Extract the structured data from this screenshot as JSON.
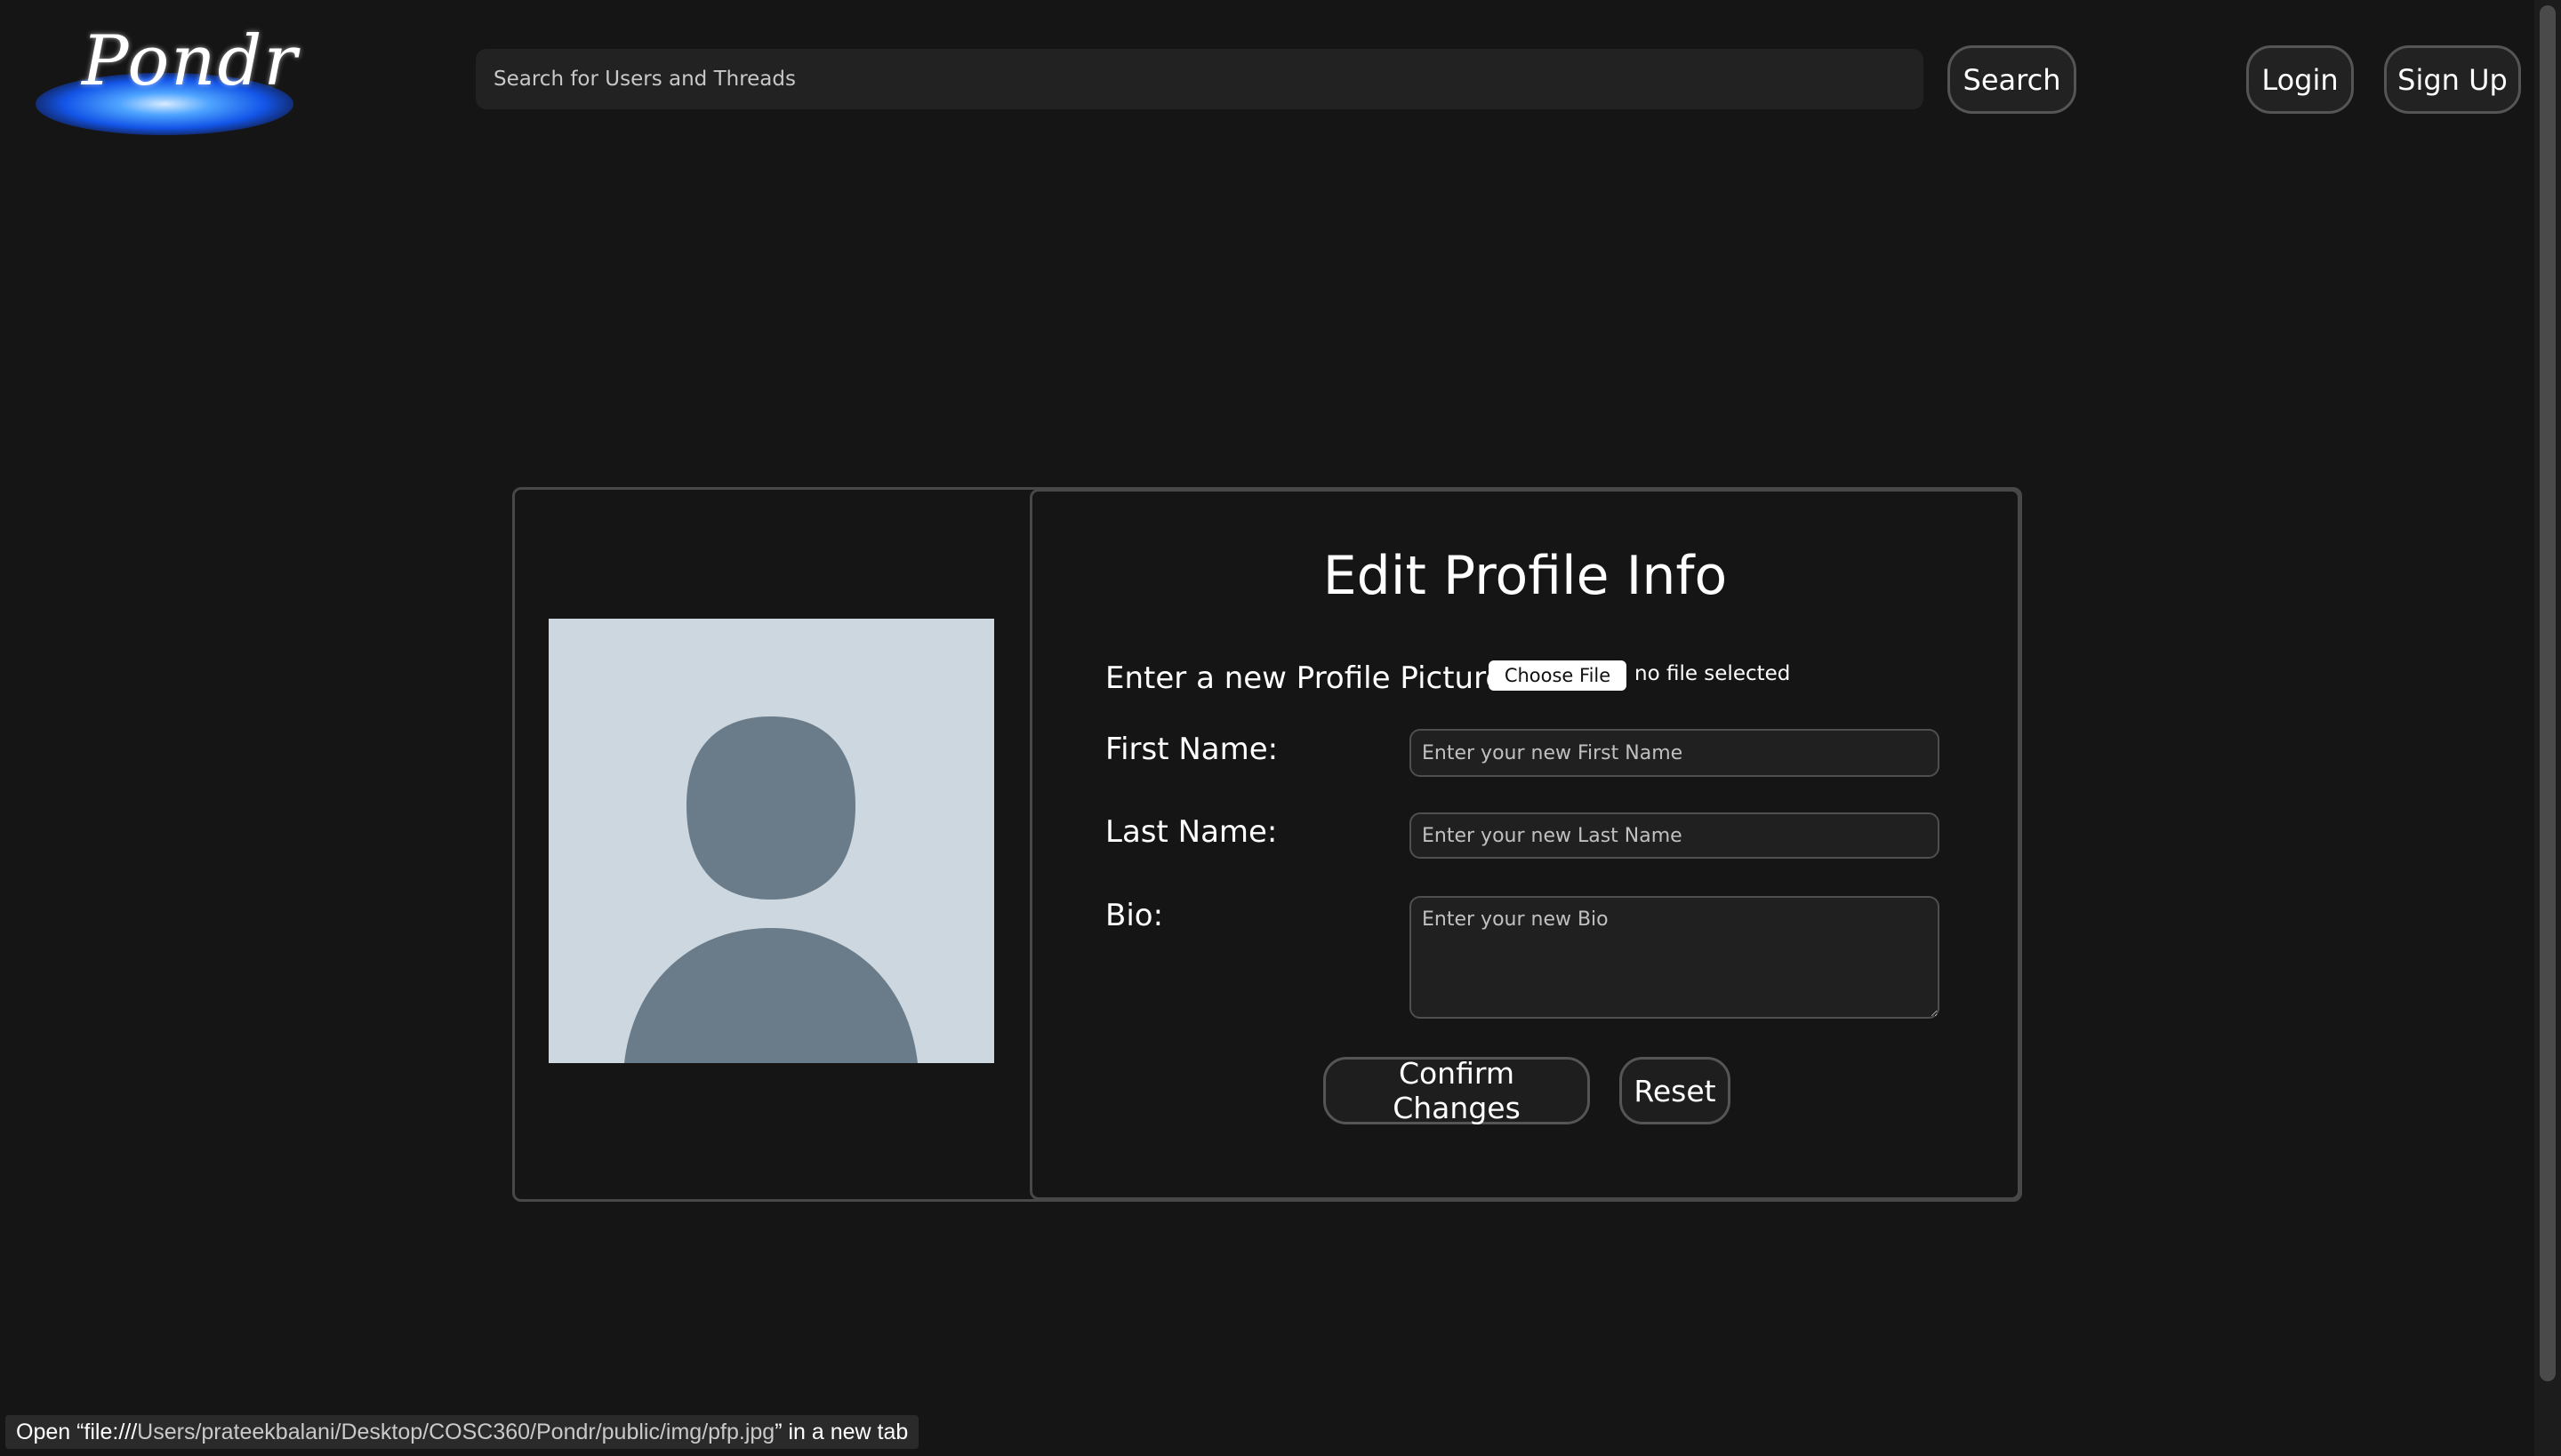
{
  "header": {
    "logo_text": "Pondr",
    "search_placeholder": "Search for Users and Threads",
    "search_button": "Search",
    "login_button": "Login",
    "signup_button": "Sign Up"
  },
  "profile": {
    "avatar_icon": "default-user-silhouette"
  },
  "form": {
    "title": "Edit Profile Info",
    "picture_label": "Enter a new Profile Picture:",
    "choose_file_button": "Choose File",
    "file_status": "no file selected",
    "first_name_label": "First Name:",
    "first_name_placeholder": "Enter your new First Name",
    "last_name_label": "Last Name:",
    "last_name_placeholder": "Enter your new Last Name",
    "bio_label": "Bio:",
    "bio_placeholder": "Enter your new Bio",
    "confirm_button": "Confirm Changes",
    "reset_button": "Reset"
  },
  "status_bar": {
    "prefix": "Open “file:///",
    "path": "Users/prateekbalani/Desktop/COSC360/Pondr/public/img/pfp.jpg",
    "suffix": "” in a new tab"
  },
  "colors": {
    "background": "#151515",
    "avatar_bg": "#cdd7df",
    "avatar_figure": "#6a7c8a",
    "border": "#484848",
    "logo_glow": "#1355e8"
  }
}
